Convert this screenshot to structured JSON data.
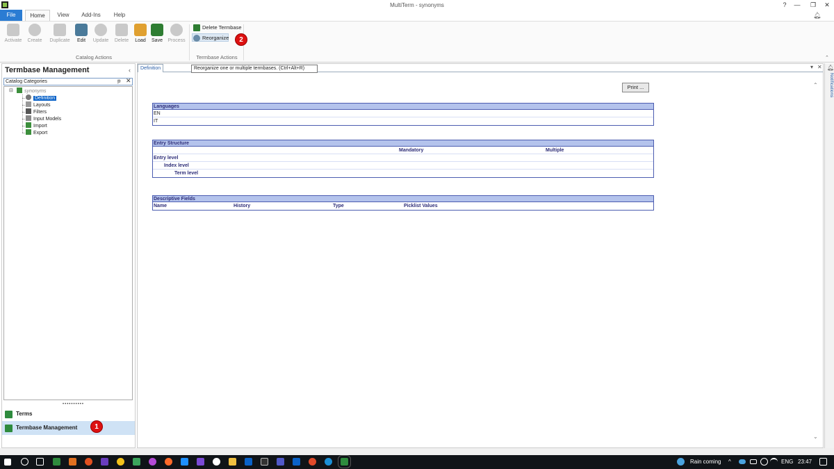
{
  "window": {
    "title": "MultiTerm - synonyms",
    "controls": {
      "help": "?",
      "minimize": "—",
      "restore": "❐",
      "close": "✕"
    }
  },
  "ribbon_tabs": [
    "File",
    "Home",
    "View",
    "Add-Ins",
    "Help"
  ],
  "ribbon": {
    "catalog_actions": {
      "label": "Catalog Actions",
      "buttons": [
        "Activate",
        "Create",
        "Duplicate",
        "Edit",
        "Update",
        "Delete",
        "Load",
        "Save",
        "Process"
      ]
    },
    "termbase_actions": {
      "label": "Termbase Actions",
      "delete_termbase": "Delete Termbase",
      "reorganize": "Reorganize"
    },
    "tooltip": "Reorganize one or multiple termbases. (Ctrl+Alt+R)"
  },
  "badges": {
    "one": "1",
    "two": "2"
  },
  "left_panel": {
    "title": "Termbase Management",
    "collapse": "‹",
    "category_search": "Catalog Categories",
    "pin": "ᵽ",
    "clear": "✕",
    "tree_root": "synonyms",
    "tree_items": [
      "Definition",
      "Layouts",
      "Filters",
      "Input Models",
      "Import",
      "Export"
    ],
    "splitter": "••••••••••",
    "nav": {
      "terms": "Terms",
      "termbase_management": "Termbase Management"
    }
  },
  "main": {
    "tab": "Definition",
    "print_button": "Print ...",
    "languages": {
      "title": "Languages",
      "rows": [
        "EN",
        "IT"
      ]
    },
    "entry_structure": {
      "title": "Entry Structure",
      "col_mandatory": "Mandatory",
      "col_multiple": "Multiple",
      "levels": [
        "Entry level",
        "Index level",
        "Term level"
      ]
    },
    "descriptive_fields": {
      "title": "Descriptive Fields",
      "cols": [
        "Name",
        "History",
        "Type",
        "Picklist Values"
      ]
    },
    "tab_controls": {
      "dropdown": "▾",
      "close": "✕"
    }
  },
  "notifications": {
    "label": "Notifications"
  },
  "taskbar": {
    "weather": "Rain coming",
    "language": "ENG",
    "time": "23:47",
    "up_arrow": "^"
  },
  "colors": {
    "accent": "#2b7cd3",
    "section_header": "#b4c3ec",
    "section_border": "#4b5cb0",
    "badge": "#dd1111",
    "active_nav": "#cfe2f5"
  }
}
